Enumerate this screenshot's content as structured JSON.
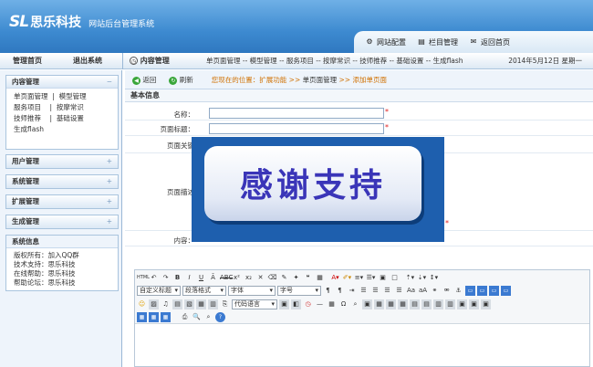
{
  "header": {
    "logo_sl": "SL",
    "logo_cn": "思乐科技",
    "subtitle": "网站后台管理系统",
    "nav": [
      {
        "label": "网站配置",
        "icon": "gear-icon"
      },
      {
        "label": "栏目管理",
        "icon": "document-icon"
      },
      {
        "label": "返回首页",
        "icon": "mail-icon"
      }
    ]
  },
  "menubar": {
    "home": "管理首页",
    "logout": "退出系统",
    "panel": "内容管理",
    "crumbs": "单页面管理 -- 模型管理 -- 服务项目 -- 按摩常识 -- 技师推荐 -- 基础设置 -- 生成flash",
    "date": "2014年5月12日 星期一"
  },
  "sidebar": {
    "content_title": "内容管理",
    "content_items": [
      "单页面管理",
      "模型管理",
      "服务项目",
      "按摩常识",
      "技师推荐",
      "基础设置",
      "生成flash"
    ],
    "sections": [
      "用户管理",
      "系统管理",
      "扩展管理",
      "生成管理"
    ],
    "info_title": "系统信息",
    "info_lines": [
      "版权所有：加入QQ群",
      "技术支持：思乐科技",
      "在线帮助：思乐科技",
      "帮助论坛：思乐科技"
    ]
  },
  "toolbar": {
    "back": "返回",
    "refresh": "刷新",
    "loc_prefix": "您现在的位置：扩展功能 >> ",
    "loc_mid": "单页面管理",
    "loc_suffix": " >> 添加单页面"
  },
  "form": {
    "section": "基本信息",
    "name": "名称：",
    "page_title": "页面标题：",
    "keywords": "页面关键",
    "desc": "页面描述",
    "content": "内容："
  },
  "editor": {
    "html": "HTML",
    "style": "自定义标题",
    "format": "段落格式",
    "font": "字体",
    "size": "字号",
    "code": "代码语言"
  },
  "overlay": {
    "text": "感谢支持"
  }
}
